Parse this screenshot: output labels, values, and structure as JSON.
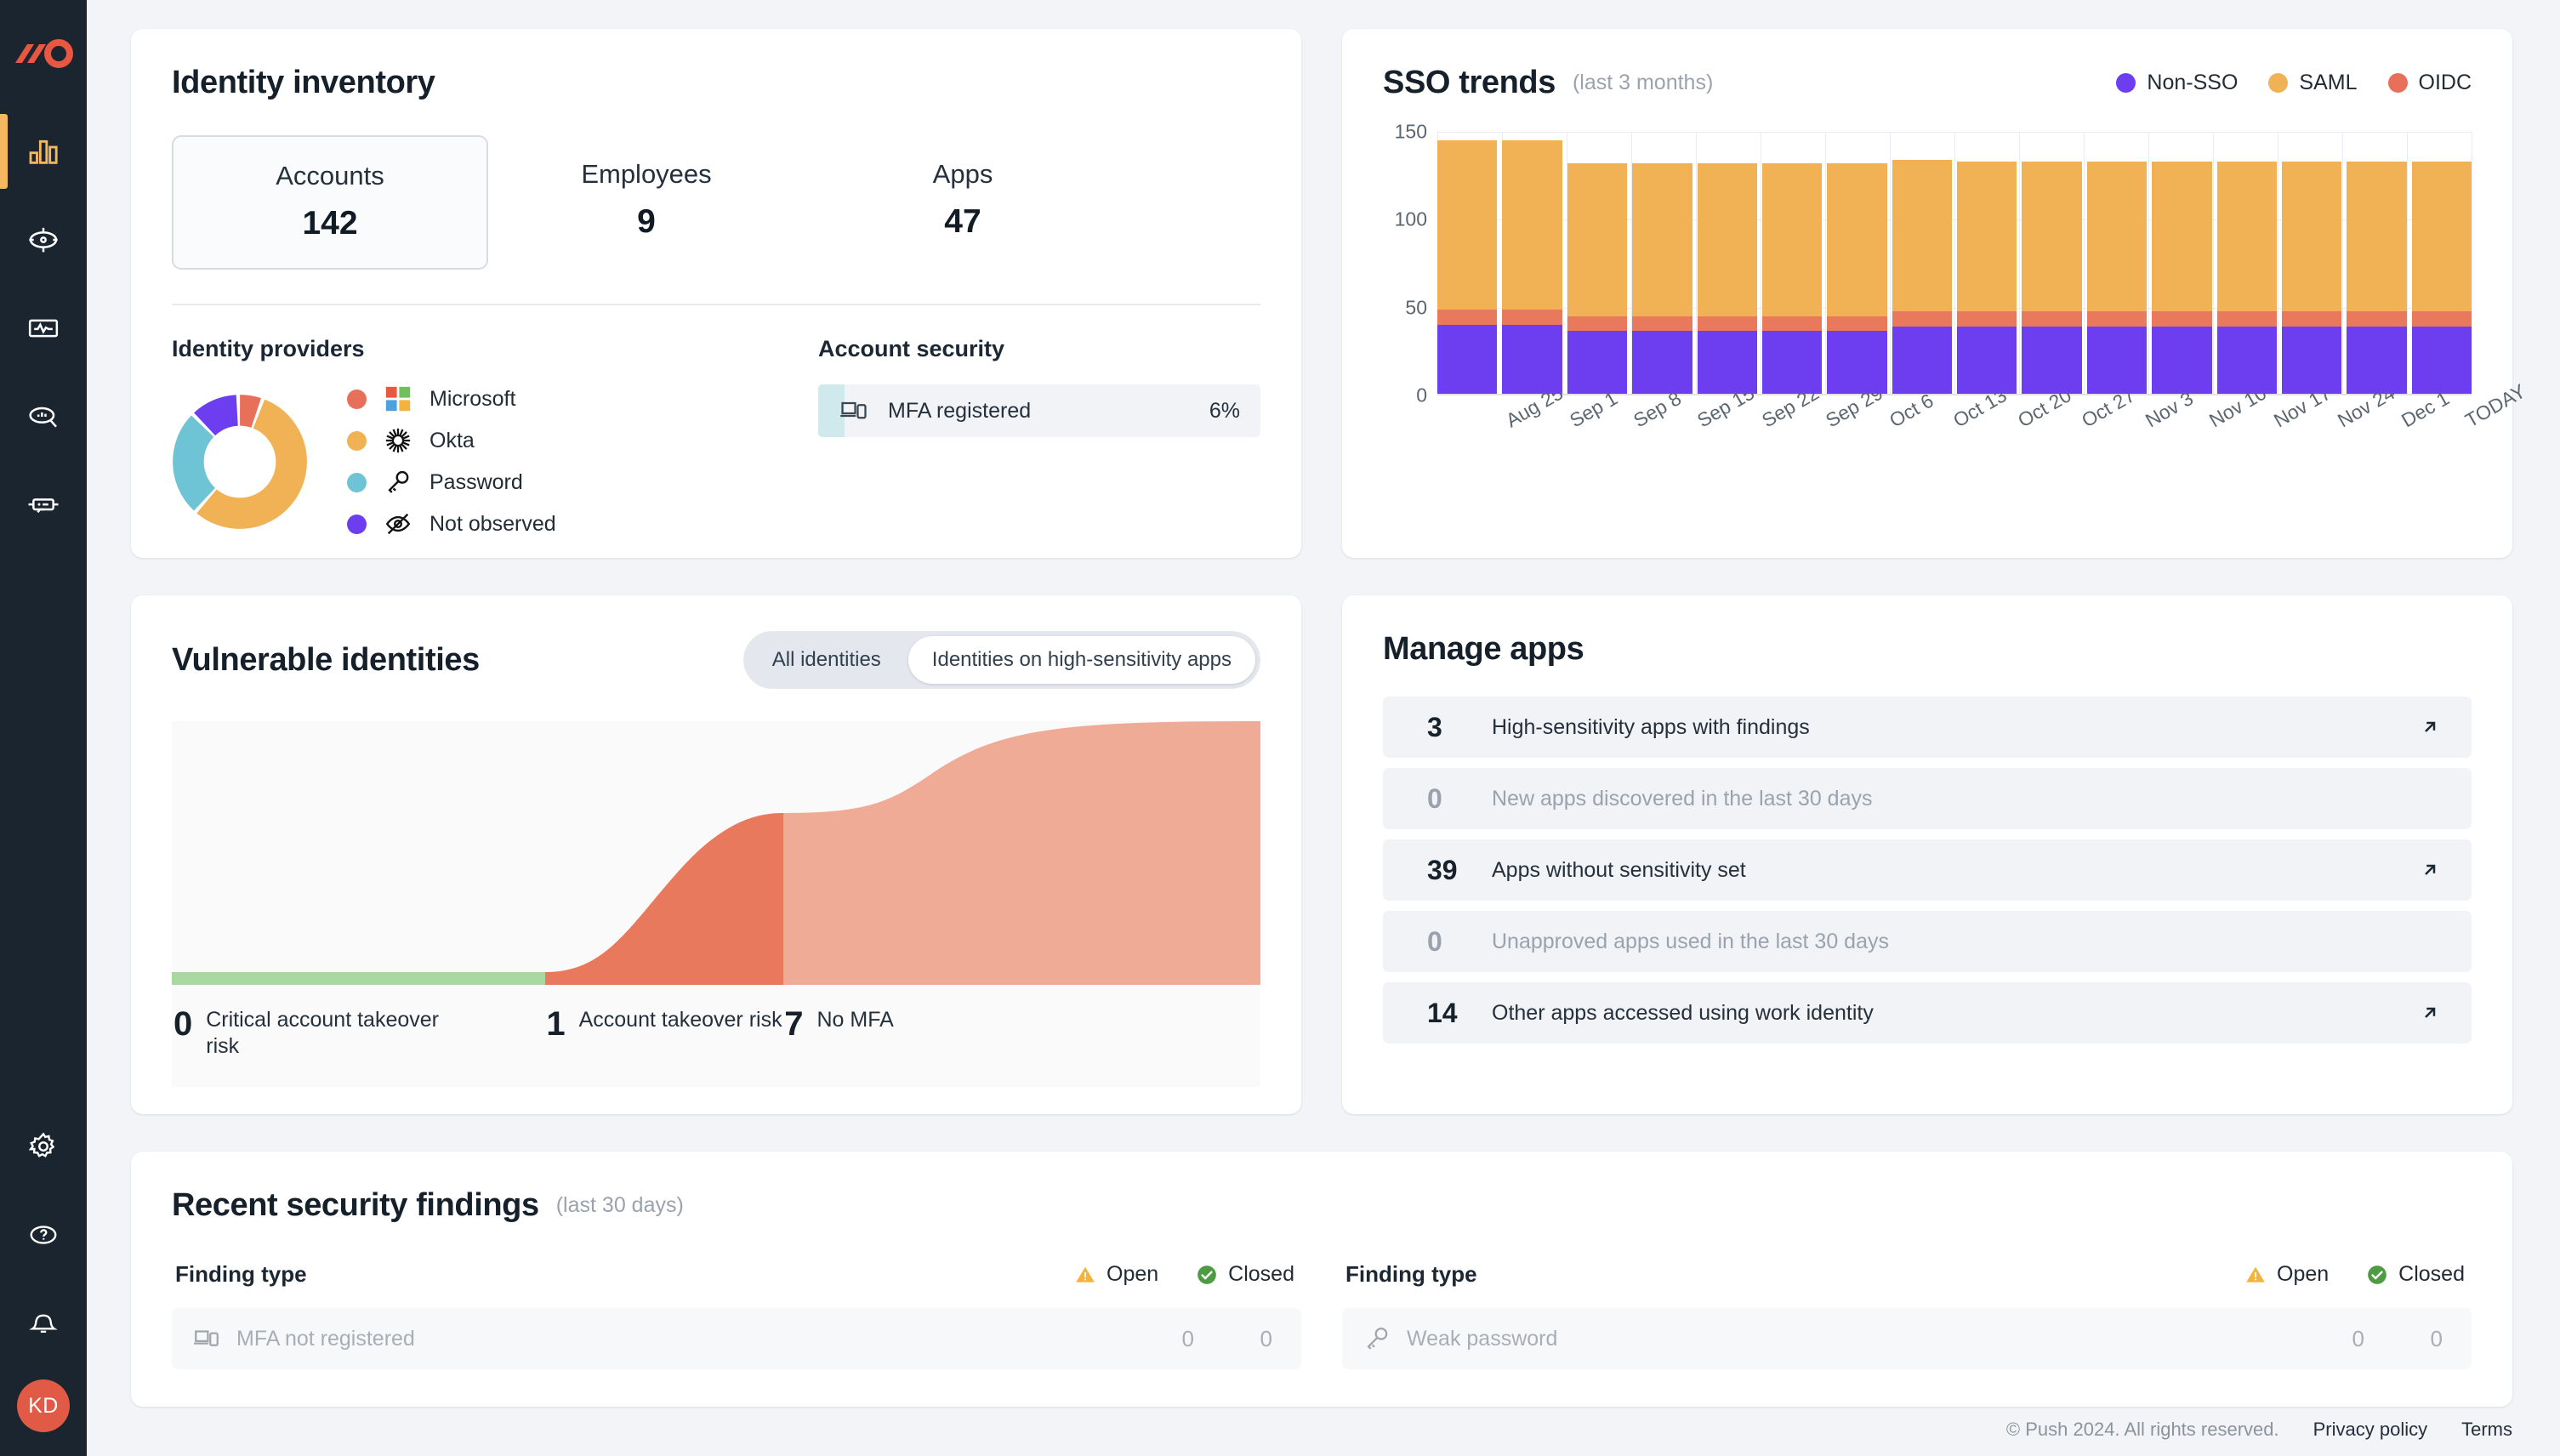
{
  "sidebar": {
    "logo": "push-logo",
    "nav": [
      {
        "name": "dashboard",
        "icon": "bar-chart-icon",
        "active": true
      },
      {
        "name": "targets",
        "icon": "crosshair-icon",
        "active": false
      },
      {
        "name": "monitor",
        "icon": "monitor-icon",
        "active": false
      },
      {
        "name": "insights",
        "icon": "search-chart-icon",
        "active": false
      },
      {
        "name": "devices",
        "icon": "browser-extension-icon",
        "active": false
      }
    ],
    "bottom": [
      {
        "name": "settings",
        "icon": "gear-icon"
      },
      {
        "name": "help",
        "icon": "question-circle-icon"
      },
      {
        "name": "notifications",
        "icon": "bell-icon"
      }
    ],
    "avatar_initials": "KD",
    "avatar_color": "#e05a45"
  },
  "identity_inventory": {
    "title": "Identity inventory",
    "stats": [
      {
        "label": "Accounts",
        "value": "142",
        "selected": true
      },
      {
        "label": "Employees",
        "value": "9",
        "selected": false
      },
      {
        "label": "Apps",
        "value": "47",
        "selected": false
      }
    ],
    "providers_title": "Identity providers",
    "providers": [
      {
        "label": "Microsoft",
        "color": "#e8705a",
        "icon": "microsoft-icon",
        "pct": 6
      },
      {
        "label": "Okta",
        "color": "#f0b254",
        "icon": "okta-icon",
        "pct": 56
      },
      {
        "label": "Password",
        "color": "#6ec4d4",
        "icon": "key-icon",
        "pct": 26
      },
      {
        "label": "Not observed",
        "color": "#6c3ef0",
        "icon": "eye-off-icon",
        "pct": 12
      }
    ],
    "account_security_title": "Account security",
    "mfa": {
      "label": "MFA registered",
      "value": "6%",
      "pct": 6,
      "icon": "mfa-device-icon",
      "fill_color": "#cfe9ec"
    }
  },
  "sso_trends": {
    "title": "SSO trends",
    "subtitle": "(last 3 months)",
    "legend": [
      {
        "label": "Non-SSO",
        "color": "#6c3ef0"
      },
      {
        "label": "SAML",
        "color": "#f0b254"
      },
      {
        "label": "OIDC",
        "color": "#e8705a"
      }
    ]
  },
  "vulnerable_identities": {
    "title": "Vulnerable identities",
    "toggle": [
      {
        "label": "All identities",
        "active": false
      },
      {
        "label": "Identities on high-sensitivity apps",
        "active": true
      }
    ],
    "segments": [
      {
        "value": "0",
        "label": "Critical account takeover risk",
        "color": "#a8d8a0"
      },
      {
        "value": "1",
        "label": "Account takeover risk",
        "color": "#e8795d"
      },
      {
        "value": "7",
        "label": "No MFA",
        "color": "#f0ab96"
      }
    ]
  },
  "manage_apps": {
    "title": "Manage apps",
    "rows": [
      {
        "count": "3",
        "label": "High-sensitivity apps with findings",
        "dim": false,
        "arrow": true
      },
      {
        "count": "0",
        "label": "New apps discovered in the last 30 days",
        "dim": true,
        "arrow": false
      },
      {
        "count": "39",
        "label": "Apps without sensitivity set",
        "dim": false,
        "arrow": true
      },
      {
        "count": "0",
        "label": "Unapproved apps used in the last 30 days",
        "dim": true,
        "arrow": false
      },
      {
        "count": "14",
        "label": "Other apps accessed using work identity",
        "dim": false,
        "arrow": true
      }
    ]
  },
  "recent_findings": {
    "title": "Recent security findings",
    "subtitle": "(last 30 days)",
    "col_header": "Finding type",
    "open_label": "Open",
    "closed_label": "Closed",
    "columns": [
      {
        "rows": [
          {
            "icon": "mfa-device-icon",
            "label": "MFA not registered",
            "open": "0",
            "closed": "0"
          }
        ]
      },
      {
        "rows": [
          {
            "icon": "key-icon",
            "label": "Weak password",
            "open": "0",
            "closed": "0"
          }
        ]
      }
    ]
  },
  "footer": {
    "copyright": "© Push 2024. All rights reserved.",
    "privacy": "Privacy policy",
    "terms": "Terms"
  },
  "chart_data": [
    {
      "type": "bar",
      "title": "SSO trends",
      "subtitle": "(last 3 months)",
      "stacked": true,
      "xlabel": "",
      "ylabel": "",
      "ylim": [
        0,
        150
      ],
      "yticks": [
        0,
        50,
        100,
        150
      ],
      "grid": true,
      "legend_position": "top-right",
      "categories": [
        "Aug 25",
        "Sep 1",
        "Sep 8",
        "Sep 15",
        "Sep 22",
        "Sep 29",
        "Oct 6",
        "Oct 13",
        "Oct 20",
        "Oct 27",
        "Nov 3",
        "Nov 10",
        "Nov 17",
        "Nov 24",
        "Dec 1",
        "TODAY"
      ],
      "series": [
        {
          "name": "Non-SSO",
          "color": "#6c3ef0",
          "values": [
            39,
            39,
            36,
            36,
            36,
            36,
            36,
            38,
            38,
            38,
            38,
            38,
            38,
            38,
            38,
            38
          ]
        },
        {
          "name": "OIDC",
          "color": "#e8795d",
          "values": [
            9,
            9,
            8,
            8,
            8,
            8,
            8,
            9,
            9,
            9,
            9,
            9,
            9,
            9,
            9,
            9
          ]
        },
        {
          "name": "SAML",
          "color": "#f0b254",
          "values": [
            96,
            96,
            87,
            87,
            87,
            87,
            87,
            86,
            85,
            85,
            85,
            85,
            85,
            85,
            85,
            85
          ]
        }
      ],
      "totals": [
        144,
        144,
        131,
        131,
        131,
        131,
        131,
        133,
        132,
        132,
        132,
        132,
        132,
        132,
        132,
        132
      ]
    },
    {
      "type": "pie",
      "title": "Identity providers",
      "donut": true,
      "labels": [
        "Microsoft",
        "Okta",
        "Password",
        "Not observed"
      ],
      "values": [
        6,
        56,
        26,
        12
      ],
      "colors": [
        "#e8705a",
        "#f0b254",
        "#6ec4d4",
        "#6c3ef0"
      ]
    },
    {
      "type": "area",
      "title": "Vulnerable identities",
      "categories": [
        "Critical account takeover risk",
        "Account takeover risk",
        "No MFA"
      ],
      "values": [
        0,
        1,
        7
      ],
      "colors": [
        "#a8d8a0",
        "#e8795d",
        "#f0ab96"
      ]
    }
  ]
}
